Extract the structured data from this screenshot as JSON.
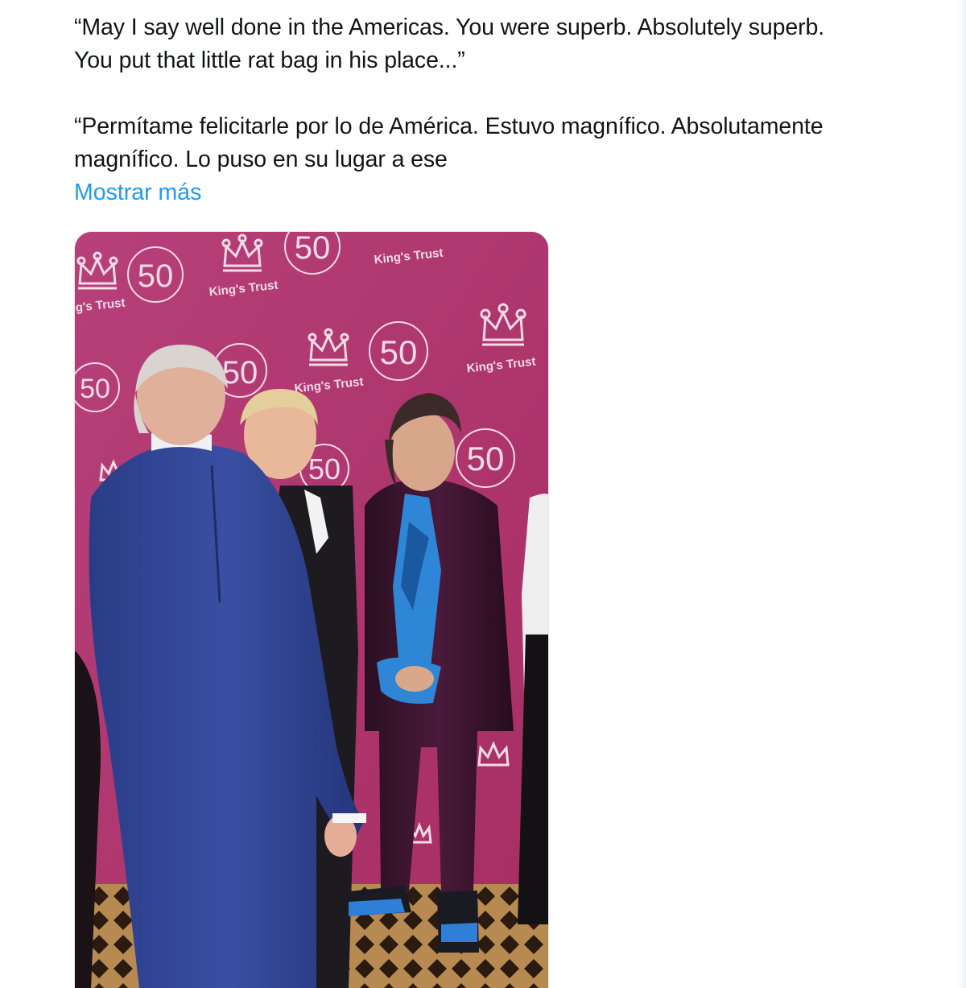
{
  "tweet": {
    "quote_en": [
      "“May I say well done in the Americas. You were superb. Absolutely superb.",
      "You put that little rat bag in his place...”"
    ],
    "quote_es": [
      "“Permítame felicitarle por lo de América. Estuvo magnífico. Absolutamente",
      "magnífico. Lo puso  en su lugar a ese"
    ],
    "show_more_label": "Mostrar más"
  },
  "media": {
    "backdrop_logo_text": "King's Trust",
    "backdrop_number": "50",
    "backdrop_color": "#b0356b"
  }
}
